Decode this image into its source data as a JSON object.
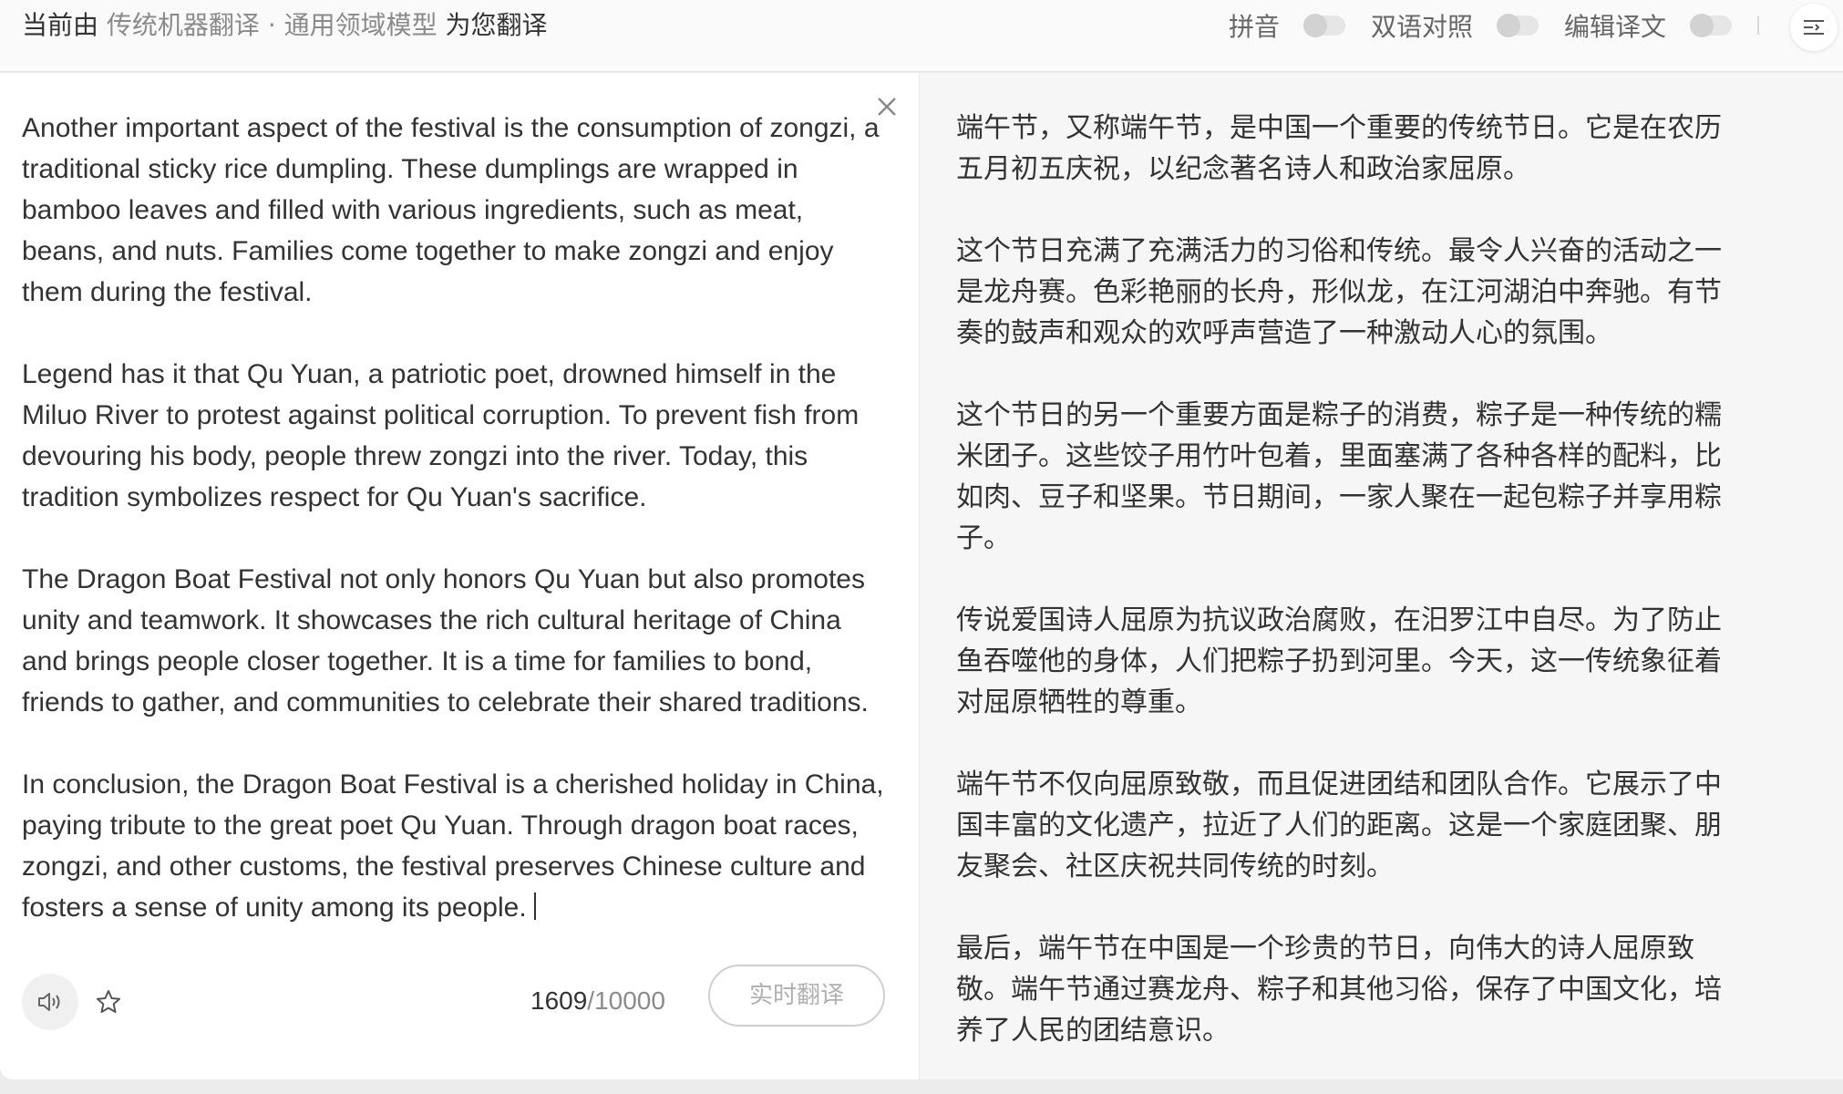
{
  "topbar": {
    "prefix": "当前由",
    "engine": "传统机器翻译 · 通用领域模型",
    "suffix": "为您翻译",
    "toggles": [
      {
        "label": "拼音",
        "on": false
      },
      {
        "label": "双语对照",
        "on": false
      },
      {
        "label": "编辑译文",
        "on": false
      }
    ],
    "menu_icon": "menu-lines-icon"
  },
  "source": {
    "paragraphs": [
      "Another important aspect of the festival is the consumption of zongzi, a traditional sticky rice dumpling. These dumplings are wrapped in bamboo leaves and filled with various ingredients, such as meat, beans, and nuts. Families come together to make zongzi and enjoy them during the festival.",
      "Legend has it that Qu Yuan, a patriotic poet, drowned himself in the Miluo River to protest against political corruption. To prevent fish from devouring his body, people threw zongzi into the river. Today, this tradition symbolizes respect for Qu Yuan's sacrifice.",
      "The Dragon Boat Festival not only honors Qu Yuan but also promotes unity and teamwork. It showcases the rich cultural heritage of China and brings people closer together. It is a time for families to bond, friends to gather, and communities to celebrate their shared traditions.",
      "In conclusion, the Dragon Boat Festival is a cherished holiday in China, paying tribute to the great poet Qu Yuan. Through dragon boat races, zongzi, and other customs, the festival preserves Chinese culture and fosters a sense of unity among its people."
    ]
  },
  "bottom": {
    "char_count": "1609",
    "char_limit": "/10000",
    "translate_label": "实时翻译"
  },
  "target": {
    "paragraphs": [
      "端午节，又称端午节，是中国一个重要的传统节日。它是在农历五月初五庆祝，以纪念著名诗人和政治家屈原。",
      "这个节日充满了充满活力的习俗和传统。最令人兴奋的活动之一是龙舟赛。色彩艳丽的长舟，形似龙，在江河湖泊中奔驰。有节奏的鼓声和观众的欢呼声营造了一种激动人心的氛围。",
      "这个节日的另一个重要方面是粽子的消费，粽子是一种传统的糯米团子。这些饺子用竹叶包着，里面塞满了各种各样的配料，比如肉、豆子和坚果。节日期间，一家人聚在一起包粽子并享用粽子。",
      "传说爱国诗人屈原为抗议政治腐败，在汨罗江中自尽。为了防止鱼吞噬他的身体，人们把粽子扔到河里。今天，这一传统象征着对屈原牺牲的尊重。",
      "端午节不仅向屈原致敬，而且促进团结和团队合作。它展示了中国丰富的文化遗产，拉近了人们的距离。这是一个家庭团聚、朋友聚会、社区庆祝共同传统的时刻。",
      "最后，端午节在中国是一个珍贵的节日，向伟大的诗人屈原致敬。端午节通过赛龙舟、粽子和其他习俗，保存了中国文化，培养了人民的团结意识。"
    ]
  },
  "colors": {
    "left_bg": "#ffffff",
    "right_bg": "#f6f6f6",
    "muted_text": "#8a8a8a",
    "body_text": "#333333"
  }
}
